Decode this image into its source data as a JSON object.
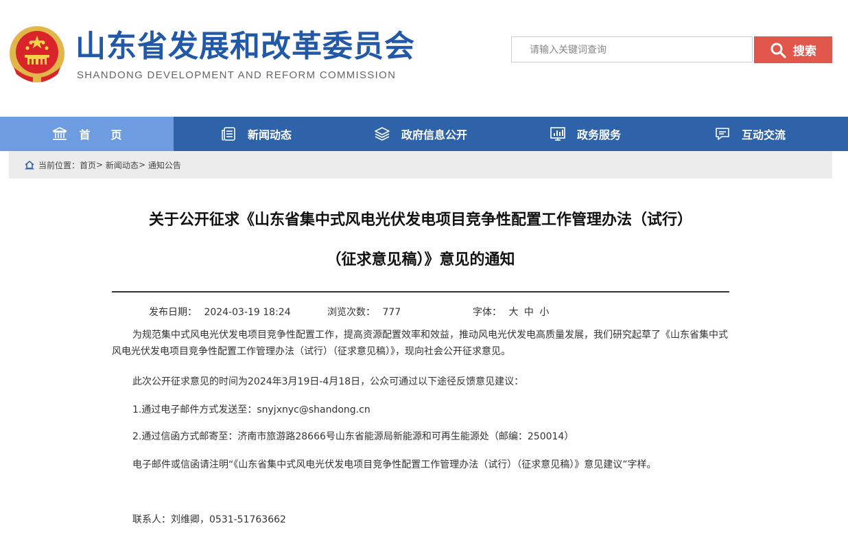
{
  "header": {
    "title": "山东省发展和改革委员会",
    "subtitle": "SHANDONG DEVELOPMENT AND REFORM COMMISSION",
    "emblem_icon": "national-emblem-icon"
  },
  "search": {
    "placeholder": "请输入关键词查询",
    "button_label": "搜索",
    "button_color": "#e2574c"
  },
  "nav": {
    "color": "#2e62a9",
    "active_color": "#6d9de0",
    "items": [
      {
        "label": "首页",
        "icon": "building-icon"
      },
      {
        "label": "新闻动态",
        "icon": "news-icon"
      },
      {
        "label": "政府信息公开",
        "icon": "layers-icon"
      },
      {
        "label": "政务服务",
        "icon": "chart-icon"
      },
      {
        "label": "互动交流",
        "icon": "chat-icon"
      }
    ]
  },
  "breadcrumb": {
    "prefix": "当前位置：",
    "items": [
      "首页",
      "新闻动态",
      "通知公告"
    ],
    "separator": ">"
  },
  "article": {
    "title_line1": "关于公开征求《山东省集中式风电光伏发电项目竞争性配置工作管理办法（试行）",
    "title_line2": "（征求意见稿）》意见的通知",
    "publish_label": "发布日期：",
    "publish_date": "2024-03-19 18:24",
    "views_label": "浏览次数：",
    "views": "777",
    "font_label": "字体：",
    "font_large": "大",
    "font_medium": "中",
    "font_small": "小",
    "paragraphs": [
      "为规范集中式风电光伏发电项目竞争性配置工作，提高资源配置效率和效益，推动风电光伏发电高质量发展，我们研究起草了《山东省集中式风电光伏发电项目竞争性配置工作管理办法（试行）（征求意见稿）》，现向社会公开征求意见。",
      "此次公开征求意见的时间为2024年3月19日-4月18日，公众可通过以下途径反馈意见建议：",
      "1.通过电子邮件方式发送至：snyjxnyc@shandong.cn",
      "2.通过信函方式邮寄至：济南市旅游路28666号山东省能源局新能源和可再生能源处（邮编：250014）",
      "电子邮件或信函请注明“《山东省集中式风电光伏发电项目竞争性配置工作管理办法（试行）（征求意见稿）》意见建议”字样。",
      "联系人：刘维卿，0531-51763662"
    ]
  }
}
